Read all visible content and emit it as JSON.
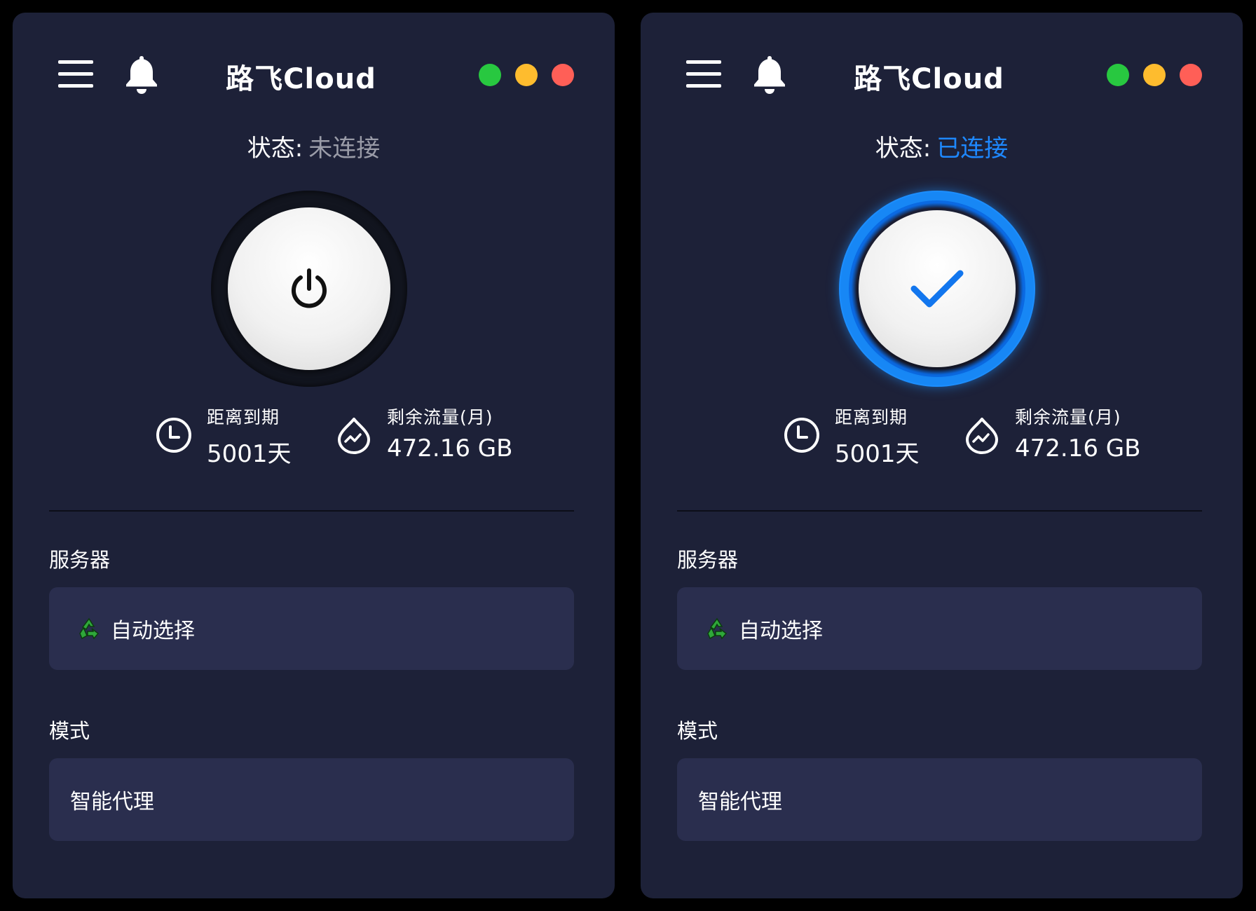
{
  "app": {
    "title": "路飞Cloud"
  },
  "colors": {
    "background": "#1d2138",
    "card": "#2a2e4e",
    "accent_blue": "#1e88ff",
    "status_disconnected": "#9a9ca8",
    "traffic_green": "#28c840",
    "traffic_yellow": "#febc2e",
    "traffic_red": "#ff5f57"
  },
  "windows": [
    {
      "state": "disconnected",
      "status_label": "状态:",
      "status_value": "未连接",
      "status_color": "#9a9ca8",
      "button_icon": "power-icon",
      "expiry_label": "距离到期",
      "expiry_value": "5001天",
      "traffic_label": "剩余流量(月)",
      "traffic_value": "472.16 GB",
      "server_section": "服务器",
      "server_value": "自动选择",
      "mode_section": "模式",
      "mode_value": "智能代理"
    },
    {
      "state": "connected",
      "status_label": "状态:",
      "status_value": "已连接",
      "status_color": "#1e88ff",
      "button_icon": "checkmark-icon",
      "expiry_label": "距离到期",
      "expiry_value": "5001天",
      "traffic_label": "剩余流量(月)",
      "traffic_value": "472.16 GB",
      "server_section": "服务器",
      "server_value": "自动选择",
      "mode_section": "模式",
      "mode_value": "智能代理"
    }
  ]
}
